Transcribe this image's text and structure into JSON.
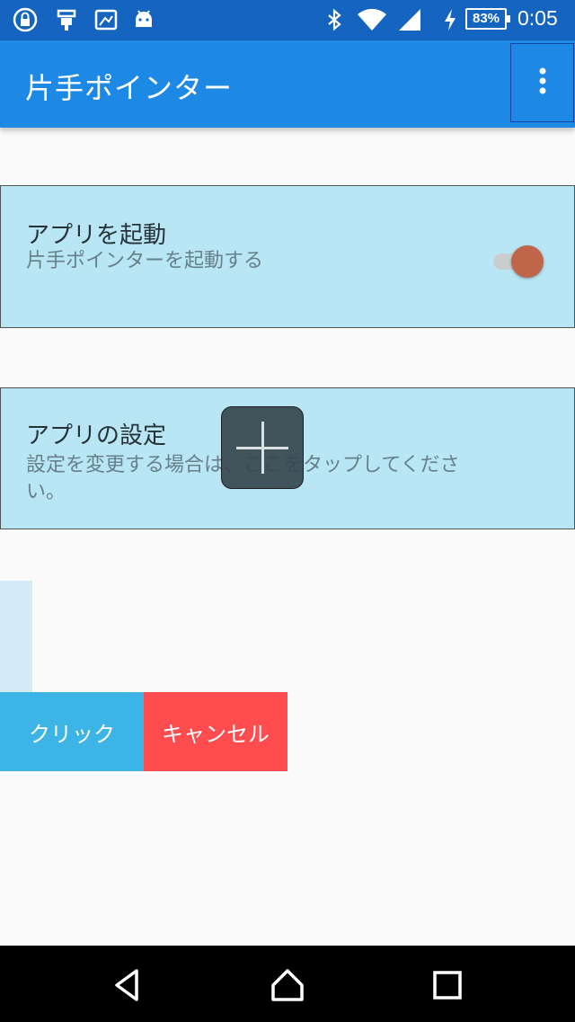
{
  "status_bar": {
    "left_icons": [
      "lock-icon",
      "usb-icon",
      "screenshot-icon",
      "android-icon"
    ],
    "right_icons": [
      "bluetooth-icon",
      "wifi-icon",
      "signal-icon",
      "charging-icon"
    ],
    "battery": "83%",
    "time": "0:05"
  },
  "app_bar": {
    "title": "片手ポインター",
    "overflow_icon": "more-vert-icon"
  },
  "settings": {
    "launch": {
      "title": "アプリを起動",
      "summary": "片手ポインターを起動する",
      "switch_on": true
    },
    "config": {
      "title": "アプリの設定",
      "summary_line1": "設定を変更する場合は、ここをタップしてくださ",
      "summary_line2": "い。"
    }
  },
  "pointer_overlay": {
    "icon": "crosshair-icon",
    "click_label": "クリック",
    "cancel_label": "キャンセル"
  },
  "nav_bar": {
    "icons": [
      "back-icon",
      "home-icon",
      "recents-icon"
    ]
  },
  "colors": {
    "status_bar": "#1565c0",
    "app_bar": "#1e88e5",
    "card": "#b9e6f4",
    "switch_thumb": "#c0644a",
    "click": "#3cb4e5",
    "cancel": "#ff4d4f"
  }
}
